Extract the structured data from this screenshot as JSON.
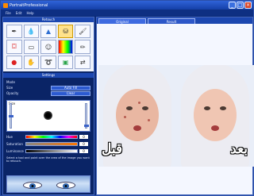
{
  "window": {
    "title": "PortraitProfessional"
  },
  "menu": {
    "items": [
      "File",
      "Edit",
      "Help"
    ]
  },
  "left_panel": {
    "tools_title": "Retouch",
    "settings_title": "Settings",
    "settings": {
      "mode_label": "Mode",
      "row1_label": "Size",
      "row1_button": "Auto Fill",
      "row2_label": "Opacity",
      "row2_button": "Clear"
    },
    "brush": {
      "size_label": "Size"
    },
    "colors": {
      "hue_label": "Hue",
      "hue_value": "0",
      "sat_label": "Saturation",
      "sat_value": "0",
      "lum_label": "Luminance",
      "lum_value": "0"
    },
    "hint": "Select a tool and paint over the area of the image you want to retouch."
  },
  "document": {
    "tabs": [
      "Original",
      "Result"
    ],
    "before_label": "قبل",
    "after_label": "بعد"
  },
  "icons": {
    "tools": [
      "pen-icon",
      "drop-icon",
      "cone-icon",
      "stamp-icon",
      "brush-icon",
      "bucket-icon",
      "eraser-icon",
      "face-icon",
      "palette-icon",
      "pencil-icon",
      "droplet-icon",
      "hand-icon",
      "lasso-icon",
      "clear-icon",
      "swap-icon"
    ]
  }
}
